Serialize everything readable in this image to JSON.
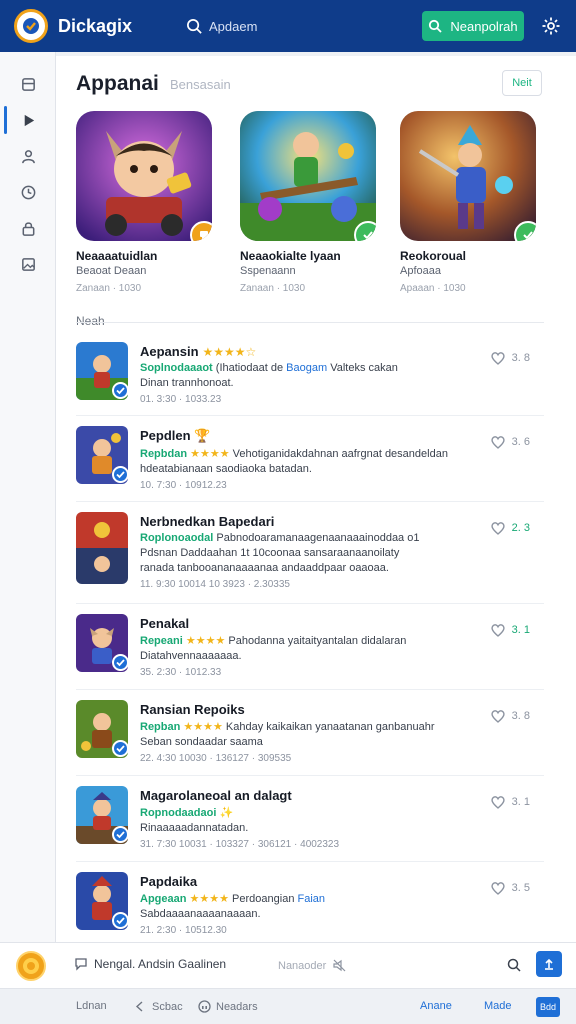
{
  "topbar": {
    "brand": "Dickagix",
    "search_placeholder": "Apdaem",
    "action_label": "Neanpolrah"
  },
  "sidebar": {
    "items": [
      {
        "icon": "inbox-icon",
        "active": false
      },
      {
        "icon": "play-icon",
        "active": true
      },
      {
        "icon": "users-icon",
        "active": false
      },
      {
        "icon": "clock-icon",
        "active": false
      },
      {
        "icon": "lock-icon",
        "active": false
      },
      {
        "icon": "image-icon",
        "active": false
      }
    ]
  },
  "page": {
    "title": "Appanai",
    "subtitle": "Bensasain",
    "header_button": "Neit"
  },
  "featured": [
    {
      "title": "Neaaaatuidlan",
      "subtitle": "Beaoat Deaan",
      "meta": "Zanaan · 1030",
      "badge_color": "#f0a21a"
    },
    {
      "title": "Neaaokialte lyaan",
      "subtitle": "Sspenaann",
      "meta": "Zanaan · 1030",
      "badge_color": "#3dbb5c"
    },
    {
      "title": "Reokoroual",
      "subtitle": "Apfoaaa",
      "meta": "Apaaan · 1030",
      "badge_color": "#3dbb5c"
    }
  ],
  "section_label": "Neah",
  "list": [
    {
      "title": "Aepansin",
      "title_stars": "★★★★☆",
      "highlight": "Soplnodaaaot",
      "line1_rest": "(Ihatiodaat de",
      "line1_link": "Baogam",
      "line1_tail": "Valteks cakan",
      "line2": "Dinan trannhonoat.",
      "meta": "01. 3:30    ·  1033.23",
      "count": "3. 8",
      "count_green": false
    },
    {
      "title": "Pepdlen",
      "title_stars": "",
      "highlight": "Repbdan",
      "line1_stars": "★★★★",
      "line1_rest": "Vehotiganidakdahnan aafrgnat desandeldan",
      "line2": "hdeatabianaan saodiaoka batadan.",
      "meta": "10. 7:30    ·  10912.23",
      "count": "3. 6",
      "count_green": false
    },
    {
      "title": "Nerbnedkan Bapedari",
      "title_stars": "",
      "highlight": "Roplonoaodal",
      "line1_rest": "Pabnodoaramanaagenaanaaainoddaa o1",
      "line2": "Pdsnan Daddaahan 1t 10coonaa sansaraanaanoilaty",
      "line3": "ranada tanbooananaaaanaa andaaddpaar oaaoaa.",
      "meta": "11. 9:30   10014   10 3923   · 2.30335",
      "count": "2. 3",
      "count_green": true
    },
    {
      "title": "Penakal",
      "title_stars": "",
      "highlight": "Repeani",
      "line1_stars": "★★★★",
      "line1_rest": "Pahodanna yaitaityantalan didalaran",
      "line2": "Diatahvennaaaaaaa.",
      "meta": "35. 2:30    ·  1012.33",
      "count": "3. 1",
      "count_green": true
    },
    {
      "title": "Ransian Repoiks",
      "title_stars": "",
      "highlight": "Repban",
      "line1_stars": "★★★★",
      "line1_rest": "Kahday kaikaikan yanaatanan ganbanuahr",
      "line2": "Seban sondaadar saama",
      "meta": "22. 4:30   10030 · 136127    · 309535",
      "count": "3. 8",
      "count_green": false
    },
    {
      "title": "Magarolaneoal an dalagt",
      "title_stars": "",
      "highlight": "Ropnodaadaoi",
      "line1_rest": "",
      "line2": "Rinaaaaadannatadan.",
      "meta": "31. 7:30   10031 · 103327    · 306121    · 4002323",
      "count": "3. 1",
      "count_green": false
    },
    {
      "title": "Papdaika",
      "title_stars": "",
      "highlight": "Apgeaan",
      "line1_stars": "★★★★",
      "line1_rest": "Perdoangian",
      "line1_link": "Faian",
      "line2": "Sabdaaaanaaaanaaaan.",
      "meta": "21. 2:30    ·  10512.30",
      "count": "3. 5",
      "count_green": false
    }
  ],
  "composer": {
    "input_text": "Nengal. Andsin Gaalinen",
    "hint": "Nanaoder"
  },
  "footer": {
    "items": [
      "Ldnan",
      "Scbac",
      "Neadars"
    ],
    "links": [
      "Anane",
      "Made"
    ],
    "button": "Bdd"
  },
  "colors": {
    "topbar": "#0f3c8a",
    "accent_green": "#1db583",
    "accent_blue": "#1f6fd6",
    "star": "#f2b51a"
  }
}
